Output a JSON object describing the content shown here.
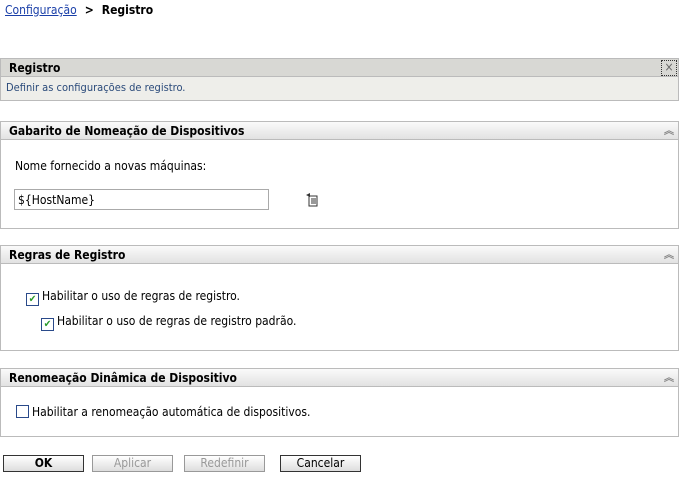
{
  "breadcrumb": {
    "link": "Configuração",
    "separator": ">",
    "current": "Registro"
  },
  "main": {
    "title": "Registro",
    "description": "Definir as configurações de registro."
  },
  "panels": [
    {
      "title": "Gabarito de Nomeação de Dispositivos",
      "field_label": "Nome fornecido a novas máquinas:",
      "field_value": "${HostName}"
    },
    {
      "title": "Regras de Registro",
      "checkboxes": [
        {
          "label": "Habilitar o uso de regras de registro.",
          "checked": true
        },
        {
          "label": "Habilitar o uso de regras de registro padrão.",
          "checked": true
        }
      ]
    },
    {
      "title": "Renomeação Dinâmica de Dispositivo",
      "checkboxes": [
        {
          "label": "Habilitar a renomeação automática de dispositivos.",
          "checked": false
        }
      ]
    }
  ],
  "buttons": {
    "ok": "OK",
    "apply": "Aplicar",
    "reset": "Redefinir",
    "cancel": "Cancelar"
  },
  "icons": {
    "close": "×",
    "collapse": "︽",
    "check": "✔"
  }
}
